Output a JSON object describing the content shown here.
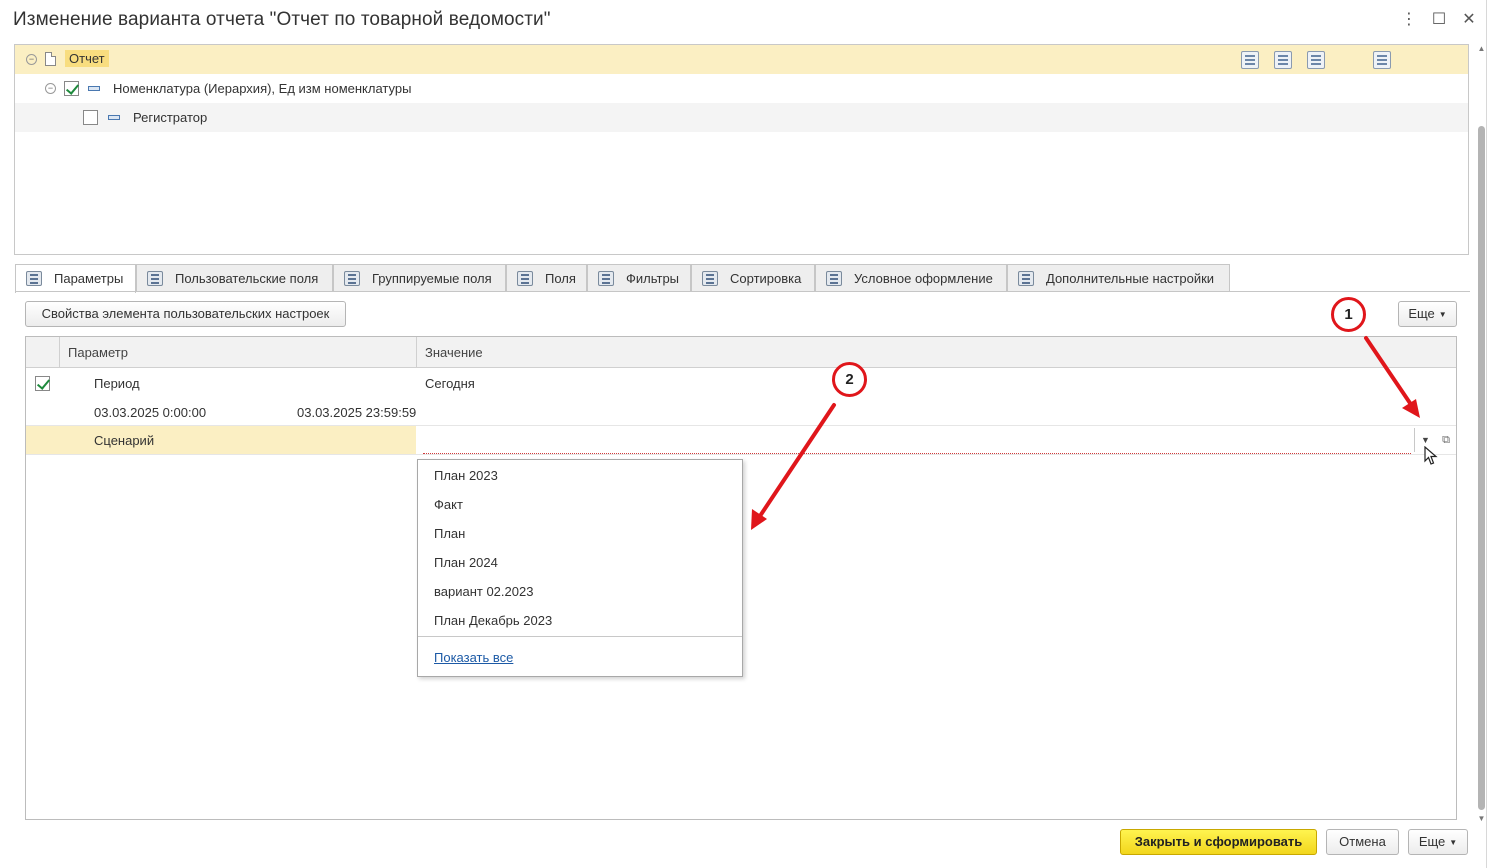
{
  "window": {
    "title": "Изменение варианта отчета \"Отчет по товарной ведомости\"",
    "controls": [
      "more-icon",
      "maximize-icon",
      "close-icon"
    ]
  },
  "tree": {
    "root_label": "Отчет",
    "item1_label": "Номенклатура (Иерархия), Ед изм номенклатуры",
    "item1_checked": true,
    "item2_label": "Регистратор",
    "item2_checked": false
  },
  "tabs": [
    {
      "label": "Параметры",
      "active": true
    },
    {
      "label": "Пользовательские поля"
    },
    {
      "label": "Группируемые поля"
    },
    {
      "label": "Поля"
    },
    {
      "label": "Фильтры"
    },
    {
      "label": "Сортировка"
    },
    {
      "label": "Условное оформление"
    },
    {
      "label": "Дополнительные настройки"
    }
  ],
  "toolbar": {
    "properties_button": "Свойства элемента пользовательских настроек",
    "more_button": "Еще"
  },
  "params_table": {
    "headers": [
      "Параметр",
      "Значение"
    ],
    "period": {
      "checked": true,
      "name": "Период",
      "value": "Сегодня",
      "start": "03.03.2025 0:00:00",
      "end": "03.03.2025 23:59:59"
    },
    "scenario": {
      "name": "Сценарий",
      "value": ""
    }
  },
  "dropdown": {
    "items": [
      "План 2023",
      "Факт",
      "План",
      "План 2024",
      "вариант 02.2023",
      "План Декабрь 2023"
    ],
    "show_all": "Показать все"
  },
  "annotations": {
    "badge1": "1",
    "badge2": "2",
    "color": "#e0161b"
  },
  "footer": {
    "close_generate": "Закрыть и сформировать",
    "cancel": "Отмена",
    "more": "Еще"
  },
  "colors": {
    "selection": "#fbefc3",
    "primary_button": "#f2d61d",
    "link": "#1c5aa6"
  }
}
